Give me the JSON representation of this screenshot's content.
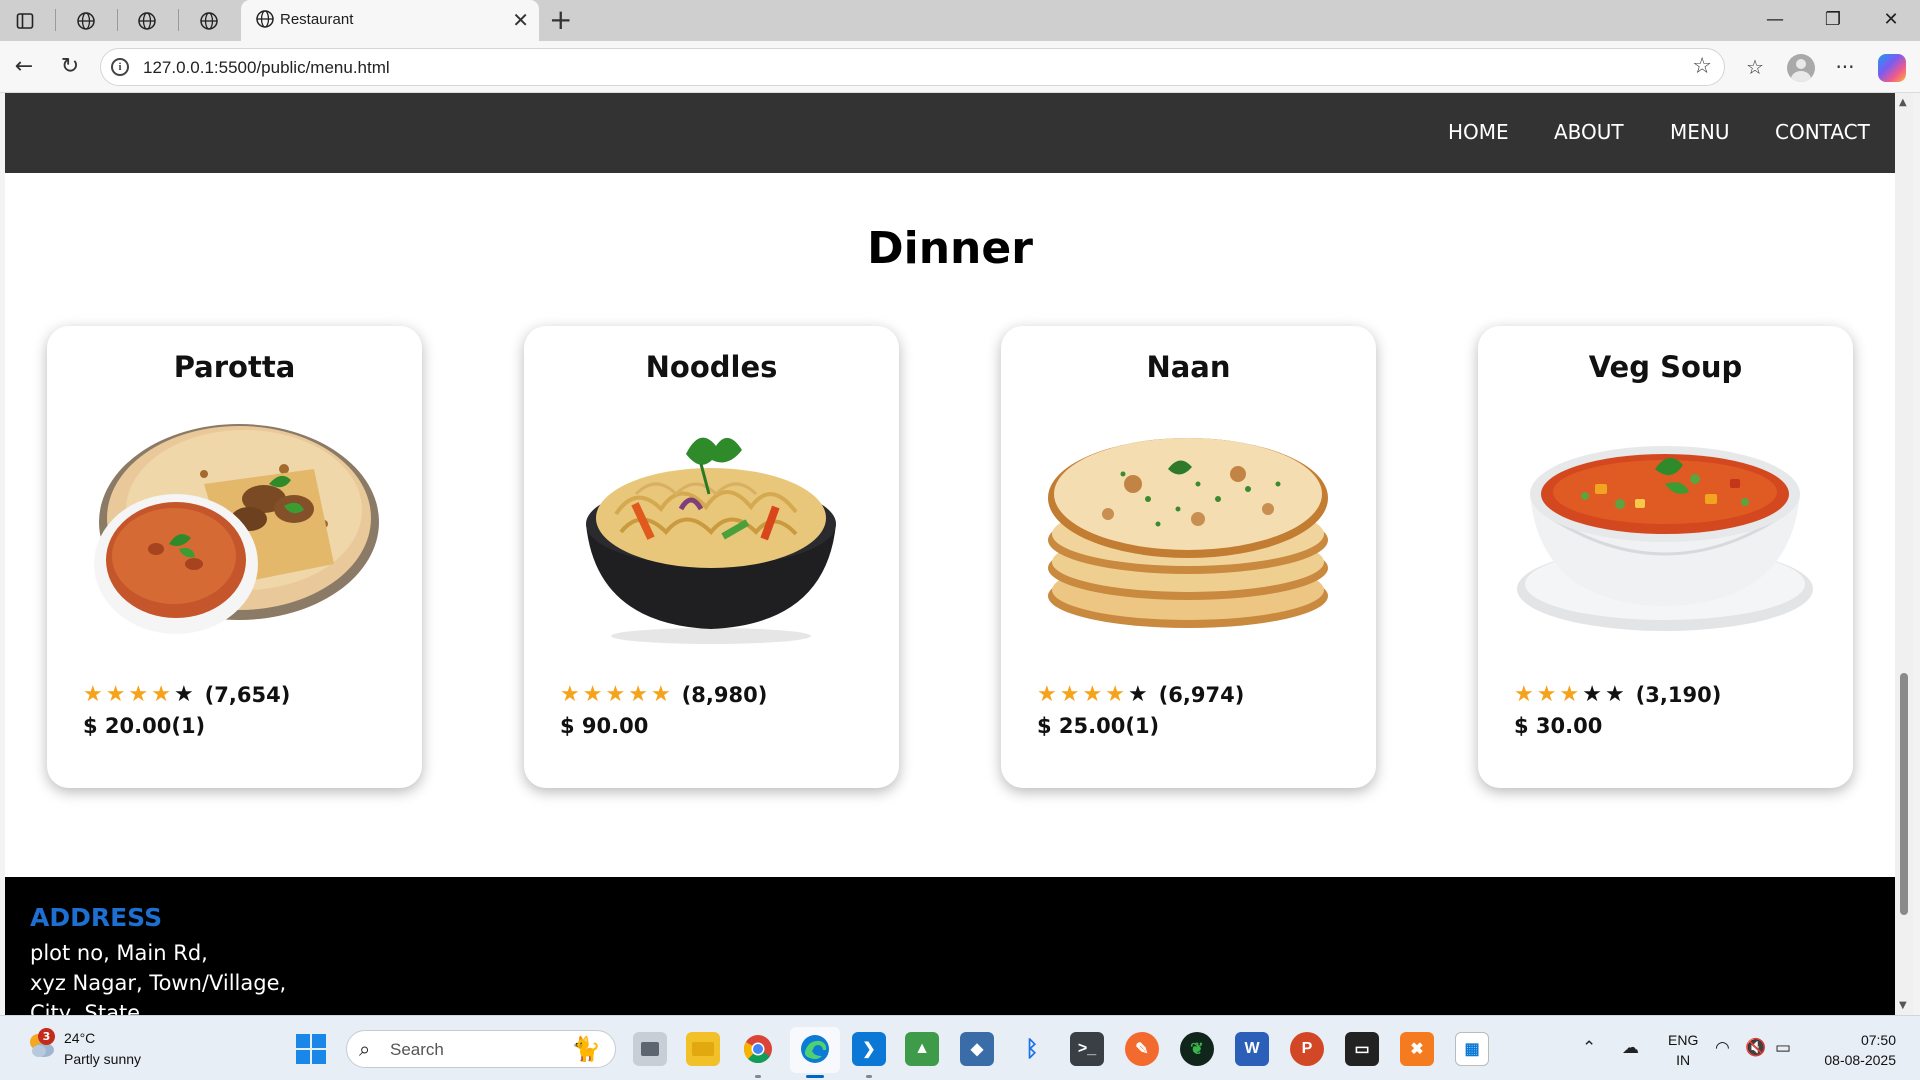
{
  "browser": {
    "tab_title": "Restaurant",
    "url": "127.0.0.1:5500/public/menu.html"
  },
  "site": {
    "nav": [
      "HOME",
      "ABOUT",
      "MENU",
      "CONTACT"
    ],
    "section_title": "Dinner",
    "items": [
      {
        "name": "Parotta",
        "stars_filled": 4,
        "stars_total": 5,
        "reviews": "(7,654)",
        "price": "$ 20.00(1)",
        "image": "parotta-dish-image"
      },
      {
        "name": "Noodles",
        "stars_filled": 5,
        "stars_total": 5,
        "reviews": "(8,980)",
        "price": "$ 90.00",
        "image": "noodles-bowl-image"
      },
      {
        "name": "Naan",
        "stars_filled": 4,
        "stars_total": 5,
        "reviews": "(6,974)",
        "price": "$ 25.00(1)",
        "image": "naan-stack-image"
      },
      {
        "name": "Veg Soup",
        "stars_filled": 3,
        "stars_total": 5,
        "reviews": "(3,190)",
        "price": "$ 30.00",
        "image": "veg-soup-bowl-image"
      }
    ],
    "footer": {
      "heading": "ADDRESS",
      "lines": [
        "plot no, Main Rd,",
        "xyz Nagar, Town/Village,",
        "City, State"
      ]
    }
  },
  "taskbar": {
    "weather_badge": "3",
    "temperature": "24°C",
    "weather": "Partly sunny",
    "search_placeholder": "Search",
    "language": [
      "ENG",
      "IN"
    ],
    "time": "07:50",
    "date": "08-08-2025"
  },
  "colors": {
    "nav_bg": "#333333",
    "star_on": "#f5a31a",
    "footer_heading": "#1d6fd1"
  }
}
